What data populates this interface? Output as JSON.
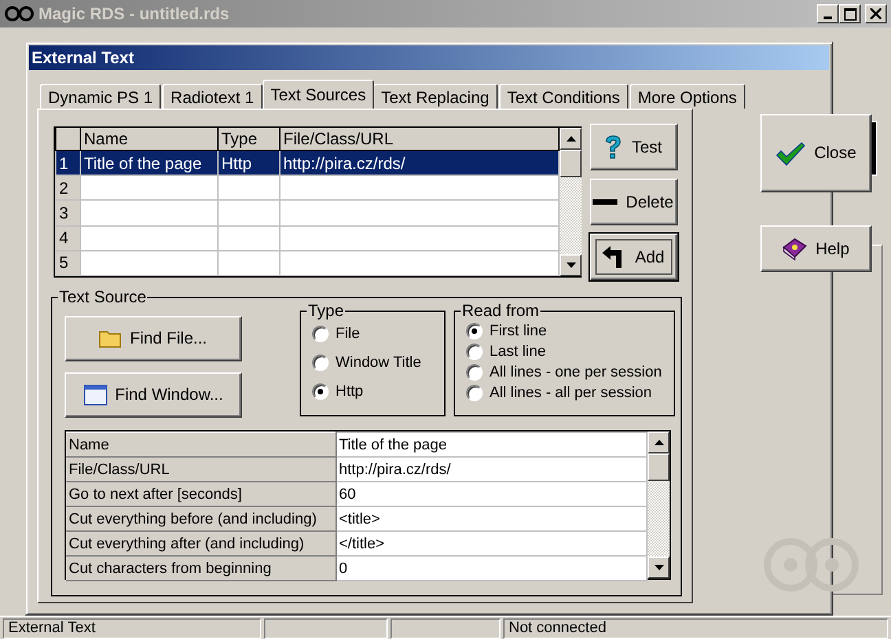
{
  "app_window": {
    "title": "Magic RDS - untitled.rds"
  },
  "dialog": {
    "title": "External Text",
    "tabs": [
      {
        "label": "Dynamic PS 1",
        "selected": false
      },
      {
        "label": "Radiotext 1",
        "selected": false
      },
      {
        "label": "Text Sources",
        "selected": true
      },
      {
        "label": "Text Replacing",
        "selected": false
      },
      {
        "label": "Text Conditions",
        "selected": false
      },
      {
        "label": "More Options",
        "selected": false
      }
    ],
    "sources_table": {
      "columns": [
        "Name",
        "Type",
        "File/Class/URL"
      ],
      "rows": [
        {
          "number": "1",
          "name": "Title of the page",
          "type": "Http",
          "url": "http://pira.cz/rds/",
          "selected": true
        },
        {
          "number": "2",
          "selected": false
        },
        {
          "number": "3",
          "selected": false
        },
        {
          "number": "4",
          "selected": false
        },
        {
          "number": "5",
          "selected": false
        }
      ]
    },
    "table_buttons": [
      {
        "label": "Test",
        "kind": "test"
      },
      {
        "label": "Delete",
        "kind": "delete"
      },
      {
        "label": "Add",
        "kind": "add",
        "focused": true
      }
    ],
    "text_source": {
      "title": "Text Source",
      "find_buttons": [
        {
          "label": "Find File...",
          "kind": "file"
        },
        {
          "label": "Find Window...",
          "kind": "window"
        }
      ],
      "type_group": {
        "title": "Type",
        "options": [
          {
            "label": "File",
            "selected": false
          },
          {
            "label": "Window Title",
            "selected": false
          },
          {
            "label": "Http",
            "selected": true
          }
        ]
      },
      "read_from": {
        "title": "Read from",
        "options": [
          {
            "label": "First line",
            "selected": true
          },
          {
            "label": "Last line",
            "selected": false
          },
          {
            "label": "All lines - one per session",
            "selected": false
          },
          {
            "label": "All lines - all per session",
            "selected": false
          }
        ]
      },
      "properties": [
        {
          "name": "Name",
          "value": "Title of the page"
        },
        {
          "name": "File/Class/URL",
          "value": "http://pira.cz/rds/"
        },
        {
          "name": "Go to next after [seconds]",
          "value": "60"
        },
        {
          "name": "Cut everything before (and including)",
          "value": "<title>"
        },
        {
          "name": "Cut everything after (and including)",
          "value": "</title>"
        },
        {
          "name": "Cut characters from beginning",
          "value": "0"
        }
      ]
    },
    "dialog_buttons": [
      {
        "label": "Close",
        "kind": "close"
      },
      {
        "label": "Help",
        "kind": "help"
      }
    ]
  },
  "status_bar": {
    "left": "External Text",
    "right": "Not connected"
  }
}
